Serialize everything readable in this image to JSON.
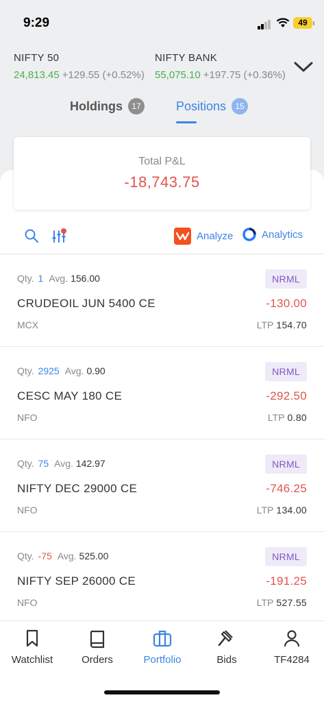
{
  "status_bar": {
    "time": "9:29",
    "battery": "49"
  },
  "indices": [
    {
      "name": "NIFTY 50",
      "price": "24,813.45",
      "change": "+129.55 (+0.52%)"
    },
    {
      "name": "NIFTY BANK",
      "price": "55,075.10",
      "change": "+197.75 (+0.36%)"
    }
  ],
  "tabs": [
    {
      "label": "Holdings",
      "count": "17"
    },
    {
      "label": "Positions",
      "count": "15"
    }
  ],
  "summary": {
    "label": "Total P&L",
    "value": "-18,743.75"
  },
  "toolbar": {
    "analyze_label": "Analyze",
    "analytics_label": "Analytics"
  },
  "positions": [
    {
      "qty_label": "Qty.",
      "qty": "1",
      "avg_label": "Avg.",
      "avg": "156.00",
      "product": "NRML",
      "symbol": "CRUDEOIL JUN 5400 CE",
      "pnl": "-130.00",
      "exchange": "MCX",
      "ltp_label": "LTP",
      "ltp": "154.70"
    },
    {
      "qty_label": "Qty.",
      "qty": "2925",
      "avg_label": "Avg.",
      "avg": "0.90",
      "product": "NRML",
      "symbol": "CESC MAY 180 CE",
      "pnl": "-292.50",
      "exchange": "NFO",
      "ltp_label": "LTP",
      "ltp": "0.80"
    },
    {
      "qty_label": "Qty.",
      "qty": "75",
      "avg_label": "Avg.",
      "avg": "142.97",
      "product": "NRML",
      "symbol": "NIFTY DEC 29000 CE",
      "pnl": "-746.25",
      "exchange": "NFO",
      "ltp_label": "LTP",
      "ltp": "134.00"
    },
    {
      "qty_label": "Qty.",
      "qty": "-75",
      "avg_label": "Avg.",
      "avg": "525.00",
      "product": "NRML",
      "symbol": "NIFTY SEP 26000 CE",
      "pnl": "-191.25",
      "exchange": "NFO",
      "ltp_label": "LTP",
      "ltp": "527.55"
    }
  ],
  "bottom_nav": [
    {
      "label": "Watchlist",
      "icon": "bookmark-icon"
    },
    {
      "label": "Orders",
      "icon": "book-icon"
    },
    {
      "label": "Portfolio",
      "icon": "briefcase-icon",
      "active": true
    },
    {
      "label": "Bids",
      "icon": "gavel-icon"
    },
    {
      "label": "TF4284",
      "icon": "user-icon"
    }
  ],
  "colors": {
    "accent": "#3d84e3",
    "positive": "#4caf50",
    "negative": "#e0554d",
    "product_badge": "#7d57c2"
  }
}
